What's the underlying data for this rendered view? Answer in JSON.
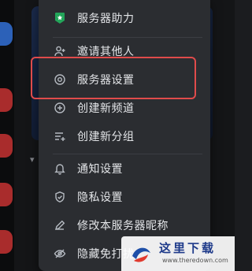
{
  "menu": {
    "items": [
      {
        "label": "服务器助力",
        "icon": "boost-badge-icon"
      },
      {
        "label": "邀请其他人",
        "icon": "person-add-icon"
      },
      {
        "label": "服务器设置",
        "icon": "settings-gear-icon"
      },
      {
        "label": "创建新频道",
        "icon": "plus-circle-icon"
      },
      {
        "label": "创建新分组",
        "icon": "add-category-icon"
      },
      {
        "label": "通知设置",
        "icon": "bell-icon"
      },
      {
        "label": "隐私设置",
        "icon": "shield-icon"
      },
      {
        "label": "修改本服务器昵称",
        "icon": "pencil-icon"
      },
      {
        "label": "隐藏免打扰",
        "icon": "eye-hidden-icon"
      }
    ]
  },
  "colors": {
    "menu_bg": "#2b2d31",
    "text": "#e3e5e8",
    "icon": "#b5bac1",
    "boost_green": "#23a55a",
    "highlight_border": "#e04b4b"
  },
  "watermark": {
    "text": "这里下载",
    "url": "www.theredown.com"
  }
}
